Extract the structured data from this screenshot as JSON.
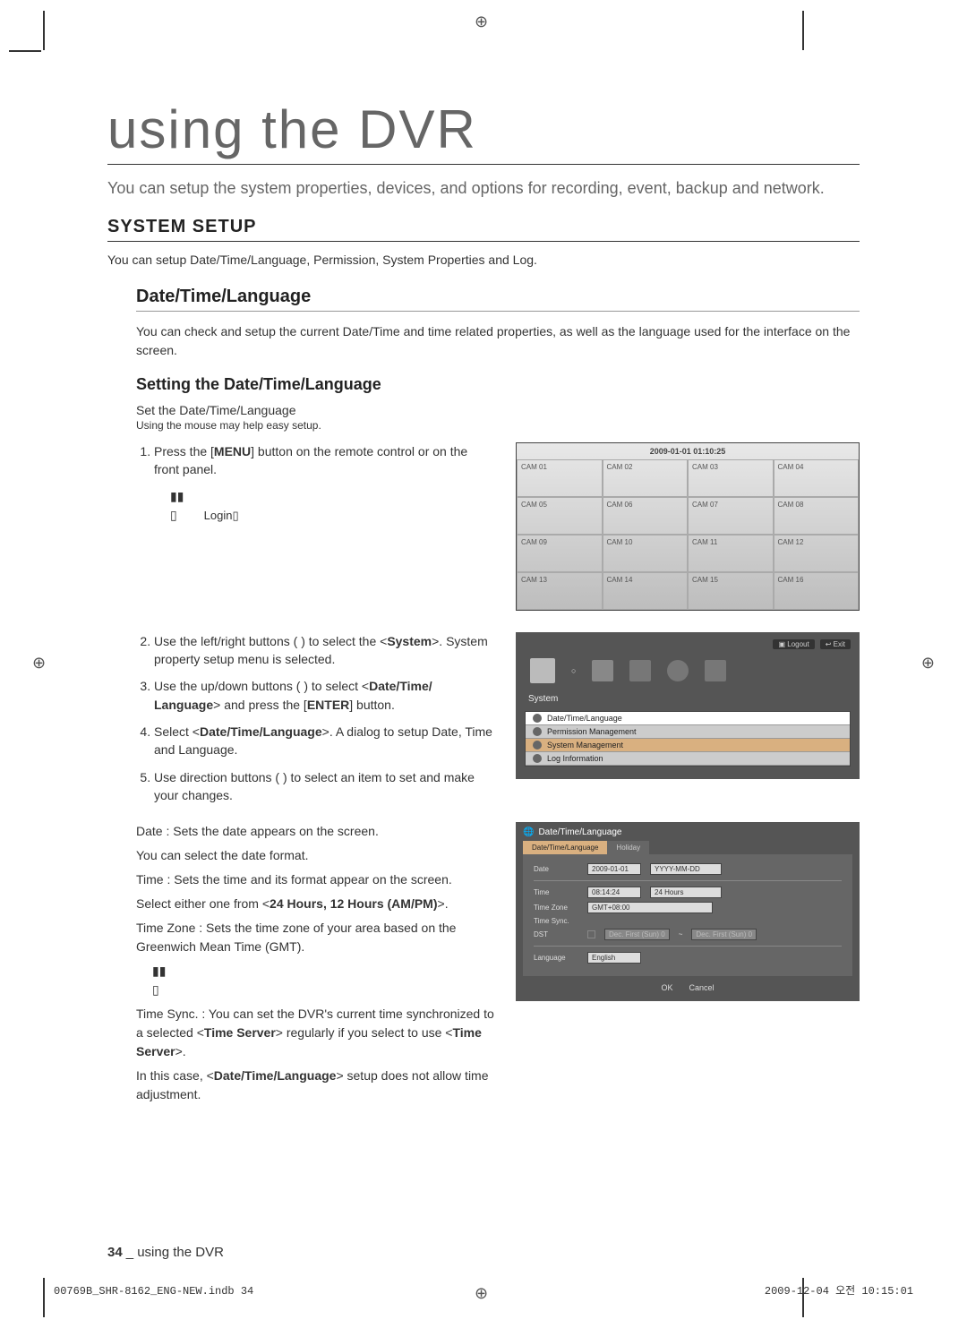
{
  "registration_marks": {
    "top": "⊕",
    "left": "⊕",
    "right": "⊕",
    "bottom": "⊕"
  },
  "title": "using the DVR",
  "intro": "You can setup the system properties, devices, and options for recording, event, backup and network.",
  "section_heading": "SYSTEM SETUP",
  "section_desc": "You can setup Date/Time/Language, Permission, System Properties and Log.",
  "sub_heading": "Date/Time/Language",
  "sub_desc": "You can check and setup the current Date/Time and time related properties, as well as the language used for the interface on the screen.",
  "subsub_heading": "Setting the Date/Time/Language",
  "stepline": "Set the Date/Time/Language",
  "note": "Using the mouse may help easy setup.",
  "steps": {
    "s1a": "Press the [",
    "s1b": "MENU",
    "s1c": "] button on the remote control or on the front panel.",
    "login_marks": "▮▮",
    "login_marker": "▯",
    "login_label": "Login",
    "login_trailing": "▯",
    "s2a": "Use the left/right buttons (         ) to select the <",
    "s2b": "System",
    "s2c": ">. System property setup menu is selected.",
    "s3a": "Use the up/down buttons (         ) to select <",
    "s3b": "Date/Time/ Language",
    "s3c": "> and press the [",
    "s3d": "ENTER",
    "s3e": "] button.",
    "s4a": "Select <",
    "s4b": "Date/Time/Language",
    "s4c": ">. A dialog to setup Date, Time and Language.",
    "s5a": "Use direction buttons (                  ) to select an item to set and make your changes."
  },
  "cam_timestamp": "2009-01-01 01:10:25",
  "cams": [
    "CAM 01",
    "CAM 02",
    "CAM 03",
    "CAM 04",
    "CAM 05",
    "CAM 06",
    "CAM 07",
    "CAM 08",
    "CAM 09",
    "CAM 10",
    "CAM 11",
    "CAM 12",
    "CAM 13",
    "CAM 14",
    "CAM 15",
    "CAM 16"
  ],
  "system_panel": {
    "logout": "Logout",
    "exit": "Exit",
    "label": "System",
    "items": [
      "Date/Time/Language",
      "Permission Management",
      "System Management",
      "Log Information"
    ]
  },
  "dtl_panel": {
    "title": "Date/Time/Language",
    "tab1": "Date/Time/Language",
    "tab2": "Holiday",
    "date_lbl": "Date",
    "date_val": "2009-01-01",
    "date_fmt": "YYYY-MM-DD",
    "time_lbl": "Time",
    "time_val": "08:14:24",
    "time_fmt": "24 Hours",
    "tz_lbl": "Time Zone",
    "tz_val": "GMT+08:00",
    "sync_lbl": "Time Sync.",
    "dst_lbl": "DST",
    "dst_from": "Dec. First (Sun) 0",
    "dst_tilde": "~",
    "dst_to": "Dec. First (Sun) 0",
    "lang_lbl": "Language",
    "lang_val": "English",
    "ok": "OK",
    "cancel": "Cancel"
  },
  "explain": {
    "p1": "Date : Sets the date appears on the screen.",
    "p2": "You can select the date format.",
    "p3": "Time : Sets the time and its format appear on the screen.",
    "p4a": "Select either one from <",
    "p4b": "24 Hours, 12 Hours (AM/PM)",
    "p4c": ">.",
    "p5": "Time Zone : Sets the time zone of your area based on the Greenwich Mean Time (GMT).",
    "marks": "▮▮",
    "marker": "▯",
    "p6a": "Time Sync. : You can set the DVR's current time synchronized to a selected <",
    "p6b": "Time Server",
    "p6c": "> regularly if you select to use <",
    "p6d": "Time Server",
    "p6e": ">.",
    "p7a": "In this case, <",
    "p7b": "Date/Time/Language",
    "p7c": "> setup does not allow time adjustment."
  },
  "footer_page": "34",
  "footer_text": "_ using the DVR",
  "print_left": "00769B_SHR-8162_ENG-NEW.indb   34",
  "print_right": "2009-12-04   오전 10:15:01"
}
